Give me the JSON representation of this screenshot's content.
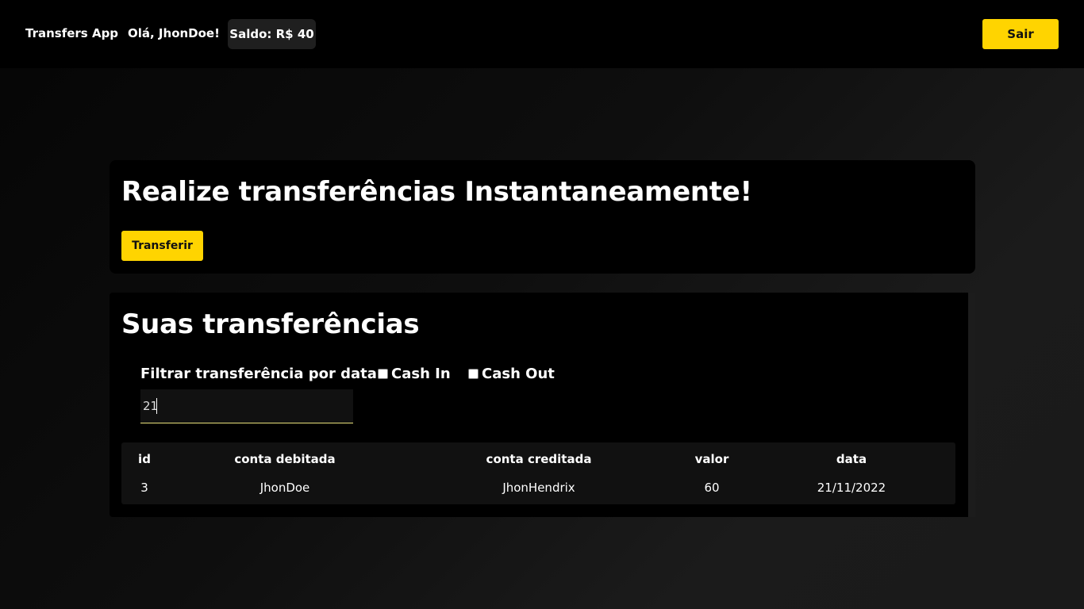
{
  "header": {
    "brand": "Transfers App",
    "greeting": "Olá, JhonDoe!",
    "balance": "Saldo: R$ 40",
    "logout_label": "Sair"
  },
  "hero": {
    "title": "Realize transferências Instantaneamente!",
    "transfer_label": "Transferir"
  },
  "transfers": {
    "title": "Suas transferências",
    "filter_label": "Filtrar transferência por data",
    "filter_value": "21",
    "cash_in_label": "Cash In",
    "cash_in_checked": false,
    "cash_out_label": "Cash Out",
    "cash_out_checked": false,
    "columns": [
      "id",
      "conta debitada",
      "conta creditada",
      "valor",
      "data"
    ],
    "rows": [
      [
        "3",
        "JhonDoe",
        "JhonHendrix",
        "60",
        "21/11/2022"
      ]
    ]
  },
  "colors": {
    "accent": "#ffd400",
    "background": "#000000",
    "panel": "#111111"
  }
}
